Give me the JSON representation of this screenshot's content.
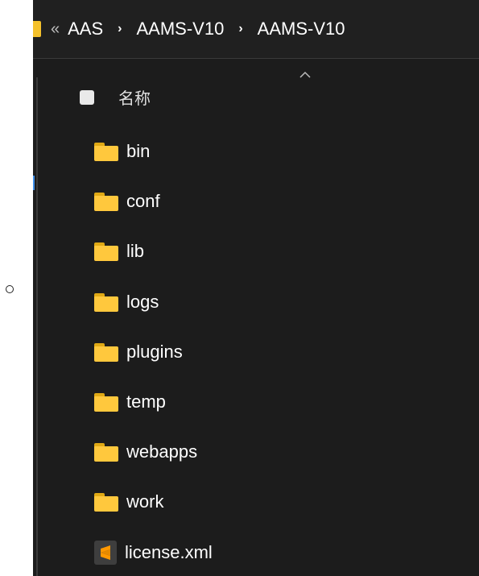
{
  "breadcrumb": {
    "overflow": "«",
    "items": [
      "AAS",
      "AAMS-V10",
      "AAMS-V10"
    ],
    "separator": "›"
  },
  "list_header": {
    "name_column": "名称"
  },
  "files": [
    {
      "name": "bin",
      "icon": "folder-icon"
    },
    {
      "name": "conf",
      "icon": "folder-icon"
    },
    {
      "name": "lib",
      "icon": "folder-icon"
    },
    {
      "name": "logs",
      "icon": "folder-icon"
    },
    {
      "name": "plugins",
      "icon": "folder-icon"
    },
    {
      "name": "temp",
      "icon": "folder-icon"
    },
    {
      "name": "webapps",
      "icon": "folder-icon"
    },
    {
      "name": "work",
      "icon": "folder-icon"
    },
    {
      "name": "license.xml",
      "icon": "sublime-text-file-icon"
    }
  ],
  "colors": {
    "background": "#1c1c1c",
    "folder": "#ffc83d",
    "sublime": "#ff9800",
    "text": "#ffffff"
  }
}
